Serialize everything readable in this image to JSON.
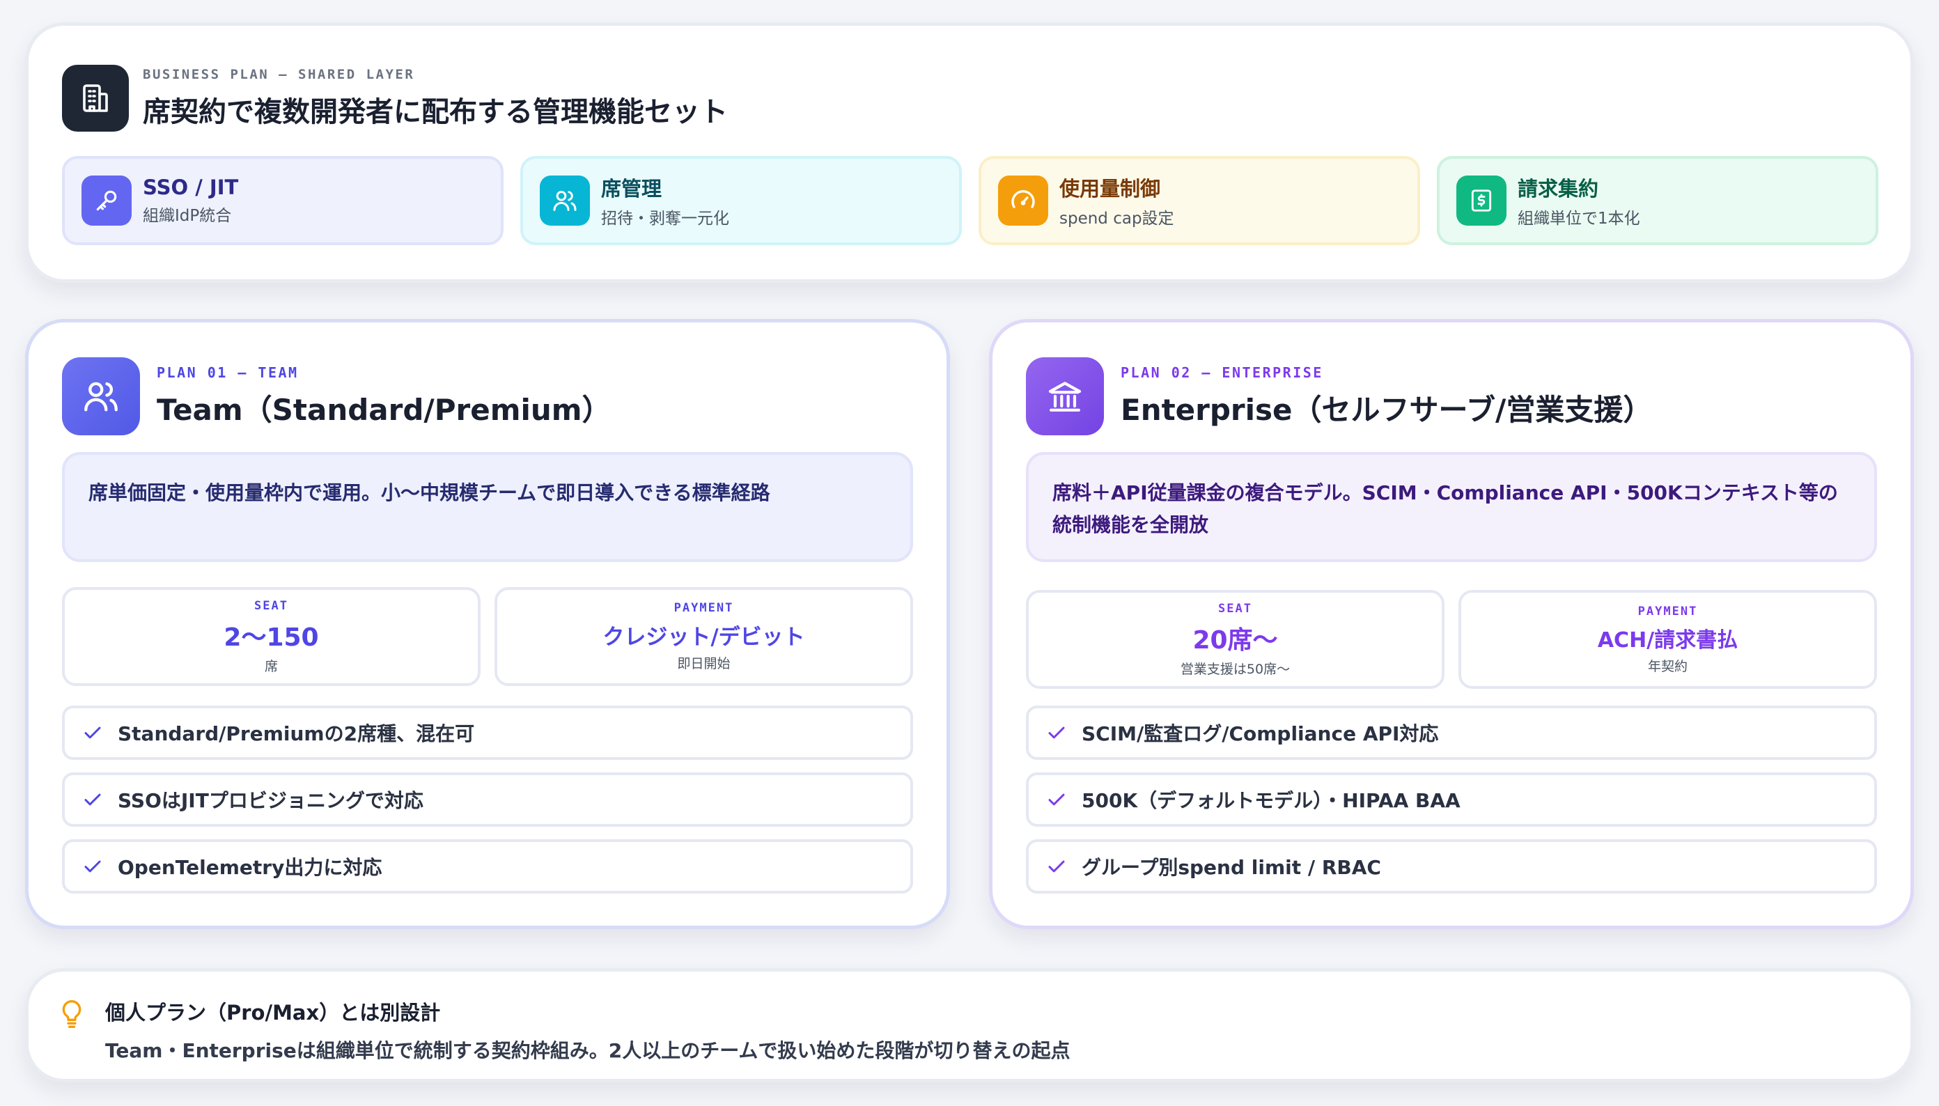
{
  "colors": {
    "team_accent": "#5b60e8",
    "enterprise_accent": "#7c4de6",
    "sso": "#6366f1",
    "seat": "#06b6d4",
    "usage": "#f59e0b",
    "billing": "#10b981",
    "note": "#f59e0b"
  },
  "shared": {
    "icon": "building-icon",
    "eyebrow": "BUSINESS PLAN — SHARED LAYER",
    "title": "席契約で複数開発者に配布する管理機能セット",
    "features": [
      {
        "icon": "key-icon",
        "title": "SSO / JIT",
        "sub": "組織IdP統合"
      },
      {
        "icon": "users-icon",
        "title": "席管理",
        "sub": "招待・剥奪一元化"
      },
      {
        "icon": "gauge-icon",
        "title": "使用量制御",
        "sub": "spend cap設定"
      },
      {
        "icon": "receipt-icon",
        "title": "請求集約",
        "sub": "組織単位で1本化"
      }
    ]
  },
  "team": {
    "icon": "users-icon",
    "eyebrow": "PLAN 01 — TEAM",
    "title": "Team（Standard/Premium）",
    "description": "席単価固定・使用量枠内で運用。小〜中規模チームで即日導入できる標準経路",
    "stats": [
      {
        "label": "SEAT",
        "value": "2〜150",
        "sub": "席"
      },
      {
        "label": "PAYMENT",
        "value": "クレジット/デビット",
        "sub": "即日開始"
      }
    ],
    "checks": [
      "Standard/Premiumの2席種、混在可",
      "SSOはJITプロビジョニングで対応",
      "OpenTelemetry出力に対応"
    ]
  },
  "enterprise": {
    "icon": "bank-icon",
    "eyebrow": "PLAN 02 — ENTERPRISE",
    "title": "Enterprise（セルフサーブ/営業支援）",
    "description": "席料＋API従量課金の複合モデル。SCIM・Compliance API・500Kコンテキスト等の統制機能を全開放",
    "stats": [
      {
        "label": "SEAT",
        "value": "20席〜",
        "sub": "営業支援は50席〜"
      },
      {
        "label": "PAYMENT",
        "value": "ACH/請求書払",
        "sub": "年契約"
      }
    ],
    "checks": [
      "SCIM/監査ログ/Compliance API対応",
      "500K（デフォルトモデル）・HIPAA BAA",
      "グループ別spend limit / RBAC"
    ]
  },
  "note": {
    "icon": "lightbulb-icon",
    "title": "個人プラン（Pro/Max）とは別設計",
    "body": "Team・Enterpriseは組織単位で統制する契約枠組み。2人以上のチームで扱い始めた段階が切り替えの起点"
  }
}
